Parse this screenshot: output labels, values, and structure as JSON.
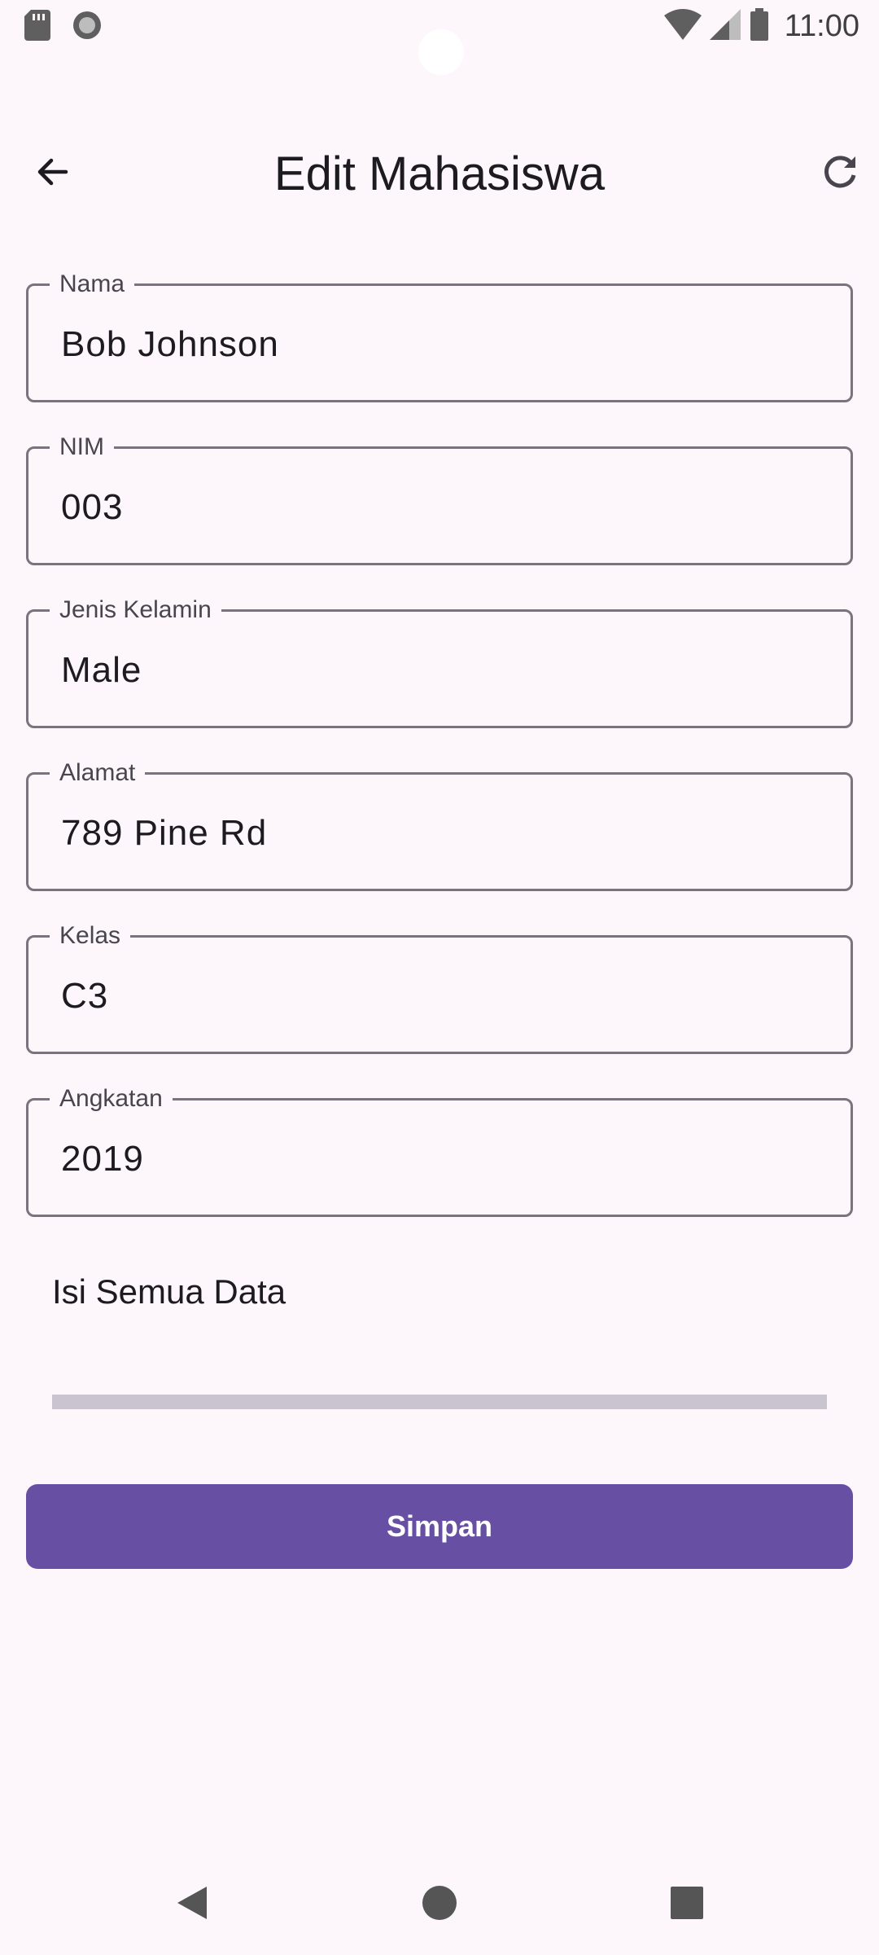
{
  "status_bar": {
    "time": "11:00",
    "icons": [
      "sd-card-icon",
      "record-icon",
      "wifi-icon",
      "signal-icon",
      "battery-icon"
    ]
  },
  "app_bar": {
    "title": "Edit Mahasiswa",
    "back_icon": "arrow-back-icon",
    "refresh_icon": "refresh-icon"
  },
  "form": {
    "fields": [
      {
        "label": "Nama",
        "value": "Bob Johnson"
      },
      {
        "label": "NIM",
        "value": "003"
      },
      {
        "label": "Jenis Kelamin",
        "value": "Male"
      },
      {
        "label": "Alamat",
        "value": "789 Pine Rd"
      },
      {
        "label": "Kelas",
        "value": "C3"
      },
      {
        "label": "Angkatan",
        "value": "2019"
      }
    ],
    "helper_text": "Isi Semua Data",
    "progress_fraction": 0,
    "save_label": "Simpan"
  },
  "colors": {
    "background": "#fdf7fc",
    "primary": "#6750a4",
    "outline": "#79747e",
    "progress_track": "#cac4d0"
  },
  "nav_bar": {
    "icons": [
      "nav-back-icon",
      "nav-home-icon",
      "nav-recents-icon"
    ]
  }
}
